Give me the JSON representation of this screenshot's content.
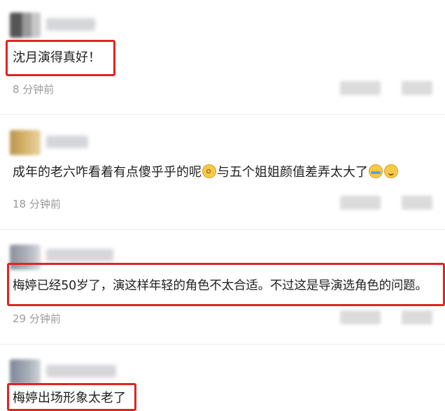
{
  "comments": [
    {
      "text": "沈月演得真好！",
      "time": "8 分钟前",
      "highlighted": true,
      "avatar_color": "#6b6b6b"
    },
    {
      "text_before": "成年的老六咋看着有点傻乎乎的呢",
      "emoji1": "dizzy-face-icon",
      "text_after": "与五个姐姐颜值差弄太大了",
      "emoji2": "crying-laughing-icon",
      "emoji3": "smiling-face-icon",
      "time": "18 分钟前",
      "highlighted": false,
      "avatar_color": "#c9a45a"
    },
    {
      "text": "梅婷已经50岁了，演这样年轻的角色不太合适。不过这是导演选角色的问题。",
      "time": "29 分钟前",
      "highlighted": true,
      "avatar_color": "#8a8f99"
    },
    {
      "text": "梅婷出场形象太老了",
      "highlighted": true,
      "avatar_color": "#7d8896"
    }
  ],
  "colors": {
    "highlight": "#e02424",
    "time_text": "#9a9a9a",
    "divider": "#ececec"
  }
}
